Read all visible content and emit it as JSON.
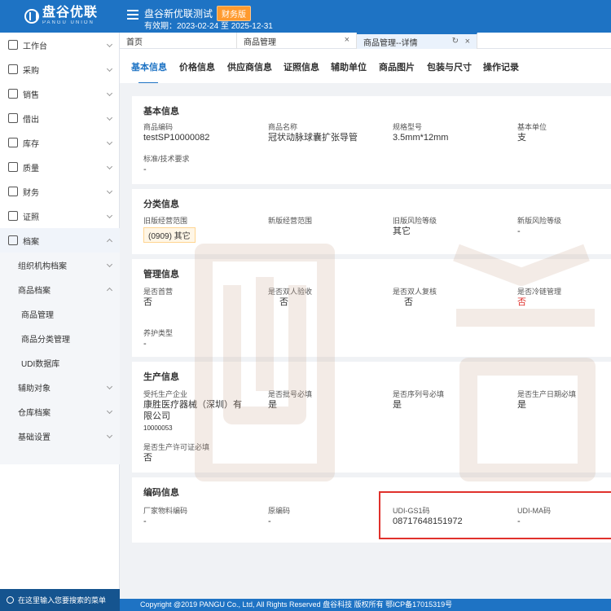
{
  "header": {
    "logo_cn": "盘谷优联",
    "logo_en": "PANGU UNION",
    "title": "盘谷新优联测试",
    "badge": "财务版",
    "validity": "有效期：2023-02-24 至 2025-12-31"
  },
  "sidebar": {
    "items": [
      {
        "label": "工作台"
      },
      {
        "label": "采购"
      },
      {
        "label": "销售"
      },
      {
        "label": "借出"
      },
      {
        "label": "库存"
      },
      {
        "label": "质量"
      },
      {
        "label": "财务"
      },
      {
        "label": "证照"
      },
      {
        "label": "档案"
      }
    ],
    "sub_items": [
      {
        "label": "组织机构档案"
      },
      {
        "label": "商品档案"
      },
      {
        "label": "商品管理"
      },
      {
        "label": "商品分类管理"
      },
      {
        "label": "UDI数据库"
      },
      {
        "label": "辅助对象"
      },
      {
        "label": "仓库档案"
      },
      {
        "label": "基础设置"
      }
    ],
    "search_placeholder": "在这里输入您要搜索的菜单"
  },
  "tabs": [
    {
      "label": "首页"
    },
    {
      "label": "商品管理"
    },
    {
      "label": "商品管理--详情"
    }
  ],
  "subnav": [
    "基本信息",
    "价格信息",
    "供应商信息",
    "证照信息",
    "辅助单位",
    "商品图片",
    "包装与尺寸",
    "操作记录"
  ],
  "basic": {
    "title": "基本信息",
    "code_label": "商品编码",
    "code": "testSP10000082",
    "name_label": "商品名称",
    "name": "冠状动脉球囊扩张导管",
    "spec_label": "规格型号",
    "spec": "3.5mm*12mm",
    "unit_label": "基本单位",
    "unit": "支",
    "standard_label": "标准/技术要求",
    "standard": "-"
  },
  "category": {
    "title": "分类信息",
    "old_scope_label": "旧版经营范围",
    "old_scope": "(0909) 其它",
    "new_scope_label": "新版经营范围",
    "old_risk_label": "旧版风险等级",
    "old_risk": "其它",
    "new_risk_label": "新版风险等级",
    "new_risk": "-"
  },
  "management": {
    "title": "管理信息",
    "first_label": "是否首营",
    "first": "否",
    "double_check_label": "是否双人验收",
    "double_check": "否",
    "double_review_label": "是否双人复核",
    "double_review": "否",
    "cold_label": "是否冷链管理",
    "cold": "否",
    "care_label": "养护类型",
    "care": "-"
  },
  "production": {
    "title": "生产信息",
    "maker_label": "受托生产企业",
    "maker_line1": "康胜医疗器械（深圳）有",
    "maker_line2": "限公司",
    "maker_code": "10000053",
    "batch_label": "是否批号必填",
    "batch": "是",
    "serial_label": "是否序列号必填",
    "serial": "是",
    "date_label": "是否生产日期必填",
    "date": "是",
    "license_label": "是否生产许可证必填",
    "license": "否"
  },
  "coding": {
    "title": "编码信息",
    "vendor_label": "厂家物料编码",
    "vendor": "-",
    "orig_label": "原编码",
    "orig": "-",
    "gs1_label": "UDI-GS1码",
    "gs1": "08717648151972",
    "ma_label": "UDI-MA码",
    "ma": "-"
  },
  "footer": "Copyright @2019 PANGU Co., Ltd, All Rights Reserved 盘谷科技 版权所有    鄂ICP备17015319号",
  "colors": {
    "primary": "#1e73c4",
    "accent": "#ff9a2e",
    "alert": "#e0312c"
  }
}
